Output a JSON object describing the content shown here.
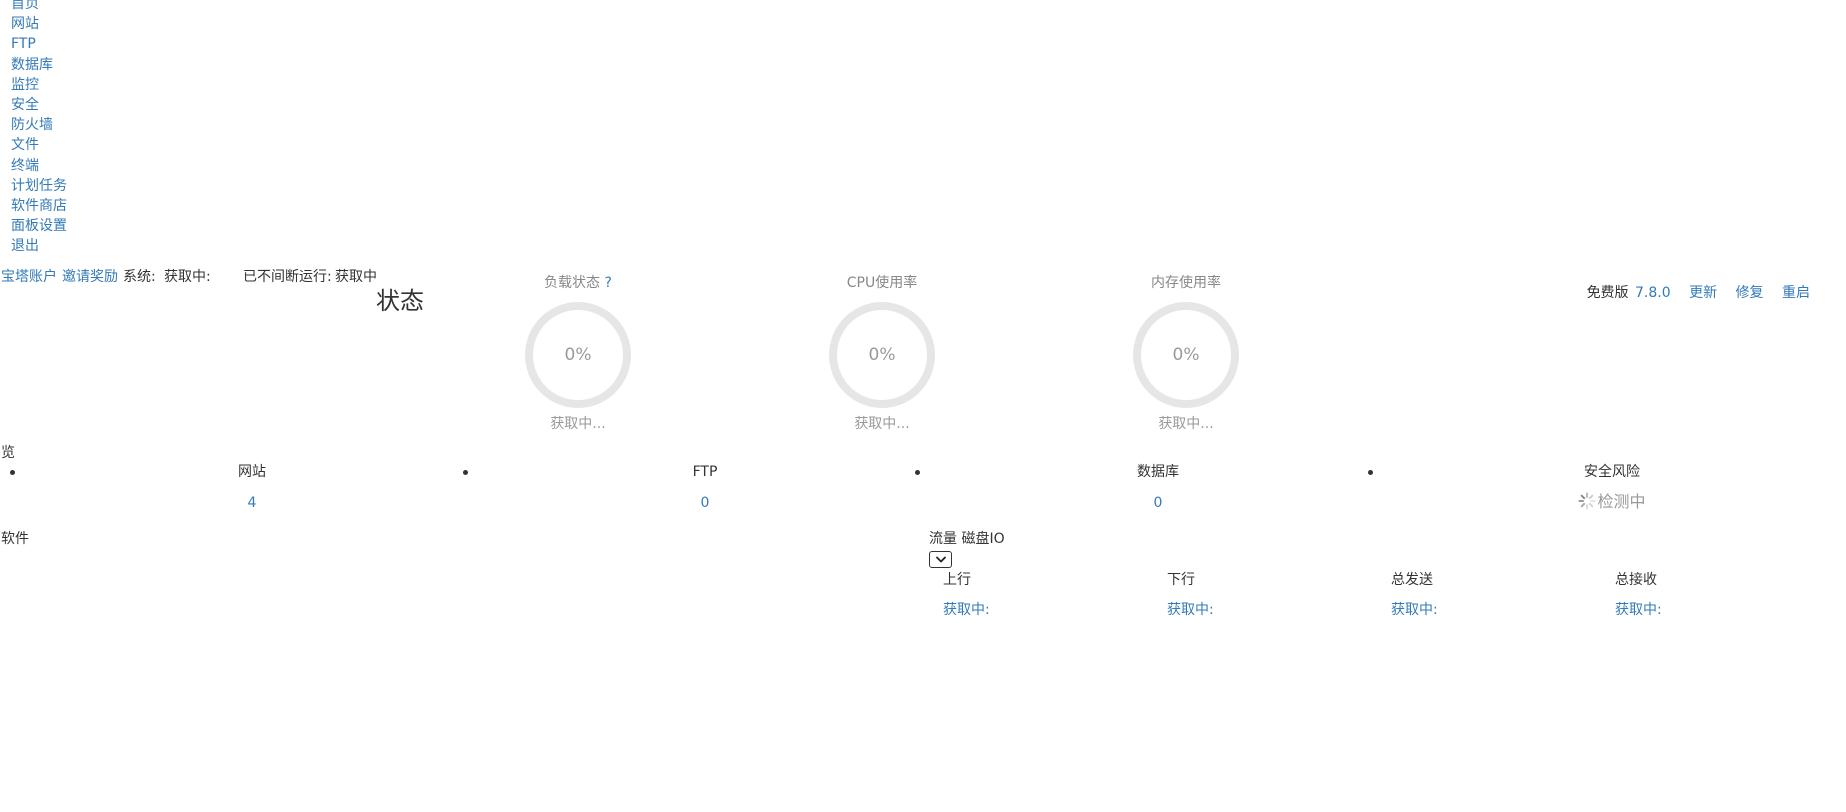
{
  "menu": [
    {
      "label": "首页"
    },
    {
      "label": "网站"
    },
    {
      "label": "FTP"
    },
    {
      "label": "数据库"
    },
    {
      "label": "监控"
    },
    {
      "label": "安全"
    },
    {
      "label": "防火墙"
    },
    {
      "label": "文件"
    },
    {
      "label": "终端"
    },
    {
      "label": "计划任务"
    },
    {
      "label": "软件商店"
    },
    {
      "label": "面板设置"
    },
    {
      "label": "退出"
    }
  ],
  "header": {
    "account": "宝塔账户",
    "invite": "邀请奖励",
    "system_label": "系统:",
    "system_value": "获取中:",
    "uptime_label": "已不间断运行:",
    "uptime_value": "获取中"
  },
  "status": {
    "title": "状态",
    "gauges": [
      {
        "title": "负载状态",
        "help": "?",
        "value": "0%",
        "status": "获取中..."
      },
      {
        "title": "CPU使用率",
        "value": "0%",
        "status": "获取中..."
      },
      {
        "title": "内存使用率",
        "value": "0%",
        "status": "获取中..."
      }
    ]
  },
  "version": {
    "edition": "免费版",
    "number": "7.8.0",
    "update": "更新",
    "repair": "修复",
    "restart": "重启"
  },
  "overview": {
    "title": "览",
    "items": [
      {
        "name": "网站",
        "value": "4"
      },
      {
        "name": "FTP",
        "value": "0"
      },
      {
        "name": "数据库",
        "value": "0"
      },
      {
        "name": "安全风险",
        "value": "检测中"
      }
    ]
  },
  "software": {
    "title": "软件"
  },
  "traffic": {
    "tab_traffic": "流量",
    "tab_disk": "磁盘IO",
    "columns": [
      {
        "label": "上行",
        "value": "获取中:"
      },
      {
        "label": "下行",
        "value": "获取中:"
      },
      {
        "label": "总发送",
        "value": "获取中:"
      },
      {
        "label": "总接收",
        "value": "获取中:"
      }
    ]
  },
  "colors": {
    "link": "#337ab7",
    "ring": "#e6e6e6",
    "muted": "#999999"
  }
}
